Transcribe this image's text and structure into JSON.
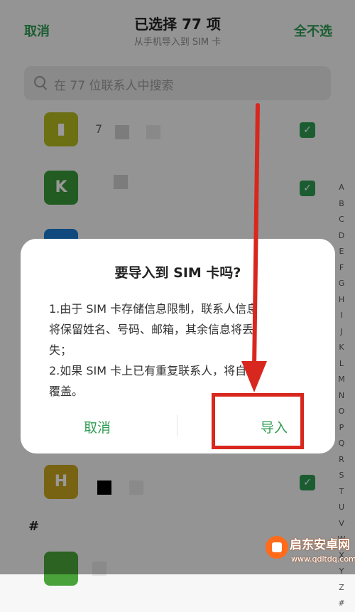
{
  "header": {
    "cancel_label": "取消",
    "title": "已选择 77 项",
    "subtitle": "从手机导入到 SIM 卡",
    "deselect_all_label": "全不选"
  },
  "search": {
    "placeholder": "在 77 位联系人中搜索"
  },
  "contacts": [
    {
      "name": "7",
      "color": "#b5bb1f",
      "checked": true
    },
    {
      "name": "",
      "color": "#3a9a3a",
      "checked": true
    },
    {
      "name": "",
      "color": "#1a7bd0",
      "checked": true
    },
    {
      "name": "",
      "color": "#c8a51f",
      "checked": true
    },
    {
      "name": "",
      "color": "#4aa33a",
      "checked": true
    }
  ],
  "alphabet_index": [
    "A",
    "B",
    "C",
    "D",
    "E",
    "F",
    "G",
    "H",
    "I",
    "J",
    "K",
    "L",
    "M",
    "N",
    "O",
    "P",
    "Q",
    "R",
    "S",
    "T",
    "U",
    "V",
    "W",
    "X",
    "Y",
    "Z",
    "#"
  ],
  "section_hash": "#",
  "dialog": {
    "title": "要导入到 SIM 卡吗?",
    "line1": "1.由于 SIM 卡存储信息限制，联系人信息",
    "line2": "将保留姓名、号码、邮箱，其余信息将丢",
    "line3": "失；",
    "line4": "2.如果 SIM 卡上已有重复联系人，将自动",
    "line5": "覆盖。",
    "cancel_label": "取消",
    "import_label": "导入"
  },
  "watermark": {
    "text": "启东安卓网",
    "url": "www.qdltdq.com"
  },
  "colors": {
    "accent": "#2e9c52",
    "annotation_red": "#d8271e"
  }
}
